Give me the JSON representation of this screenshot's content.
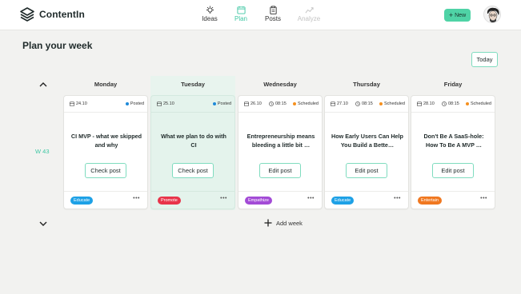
{
  "app": {
    "name": "ContentIn"
  },
  "nav": [
    {
      "label": "Ideas",
      "icon": "bulb-icon",
      "state": "normal"
    },
    {
      "label": "Plan",
      "icon": "calendar-icon",
      "state": "active"
    },
    {
      "label": "Posts",
      "icon": "clipboard-icon",
      "state": "normal"
    },
    {
      "label": "Analyze",
      "icon": "chart-icon",
      "state": "disabled"
    }
  ],
  "header": {
    "new_label": "New"
  },
  "page": {
    "title": "Plan your week",
    "today_label": "Today",
    "week_label": "W 43",
    "add_week_label": "Add week"
  },
  "colors": {
    "accent": "#3fc7a3",
    "button": "#4fd3a6",
    "highlight_bg": "#e8f4ee"
  },
  "days": [
    {
      "name": "Monday",
      "date": "24.10",
      "time": "",
      "status": "Posted",
      "status_color": "#1f8ad9",
      "title": "CI MVP - what we skipped and why",
      "action": "Check post",
      "tag": "Educate",
      "tag_color": "#1ea1e6",
      "highlight": false
    },
    {
      "name": "Tuesday",
      "date": "25.10",
      "time": "",
      "status": "Posted",
      "status_color": "#1f8ad9",
      "title": "What we plan to do with CI",
      "action": "Check post",
      "tag": "Promote",
      "tag_color": "#e8344a",
      "highlight": true
    },
    {
      "name": "Wednesday",
      "date": "26.10",
      "time": "08:15",
      "status": "Scheduled",
      "status_color": "#f5901f",
      "title": "Entrepreneurship means bleeding a little bit …",
      "action": "Edit post",
      "tag": "Empathize",
      "tag_color": "#a34bd6",
      "highlight": false
    },
    {
      "name": "Thursday",
      "date": "27.10",
      "time": "08:15",
      "status": "Scheduled",
      "status_color": "#f5901f",
      "title": "How Early Users Can Help You Build a Bette…",
      "action": "Edit post",
      "tag": "Educate",
      "tag_color": "#1ea1e6",
      "highlight": false
    },
    {
      "name": "Friday",
      "date": "28.10",
      "time": "08:15",
      "status": "Scheduled",
      "status_color": "#f5901f",
      "title": "Don't Be A SaaS-hole: How To Be A MVP …",
      "action": "Edit post",
      "tag": "Entertain",
      "tag_color": "#f07820",
      "highlight": false
    }
  ]
}
